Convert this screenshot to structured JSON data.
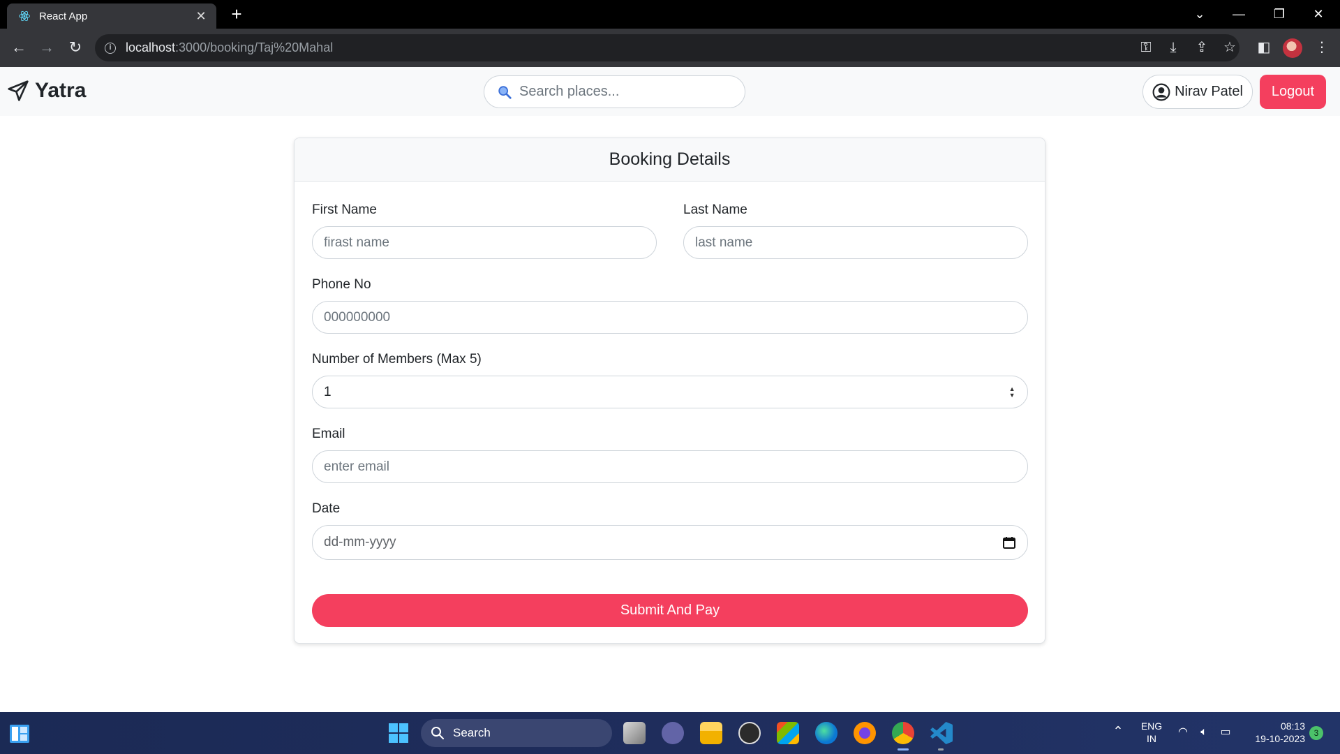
{
  "browser": {
    "tab_title": "React App",
    "tab_close": "✕",
    "new_tab": "+",
    "url_host": "localhost",
    "url_path": ":3000/booking/Taj%20Mahal"
  },
  "nav": {
    "brand": "Yatra",
    "search_placeholder": "Search places...",
    "user_name": "Nirav Patel",
    "logout_label": "Logout"
  },
  "booking": {
    "title": "Booking Details",
    "first_name_label": "First Name",
    "first_name_placeholder": "firast name",
    "last_name_label": "Last Name",
    "last_name_placeholder": "last name",
    "phone_label": "Phone No",
    "phone_placeholder": "000000000",
    "members_label": "Number of Members (Max 5)",
    "members_value": "1",
    "email_label": "Email",
    "email_placeholder": "enter email",
    "date_label": "Date",
    "date_placeholder": "dd-mm-yyyy",
    "submit_label": "Submit And Pay"
  },
  "taskbar": {
    "search_label": "Search",
    "lang_line1": "ENG",
    "lang_line2": "IN",
    "time": "08:13",
    "date": "19-10-2023",
    "notification_count": "3"
  },
  "colors": {
    "accent": "#f43f5e",
    "navbar_bg": "#f8f9fa",
    "chrome_bg": "#35363a"
  }
}
